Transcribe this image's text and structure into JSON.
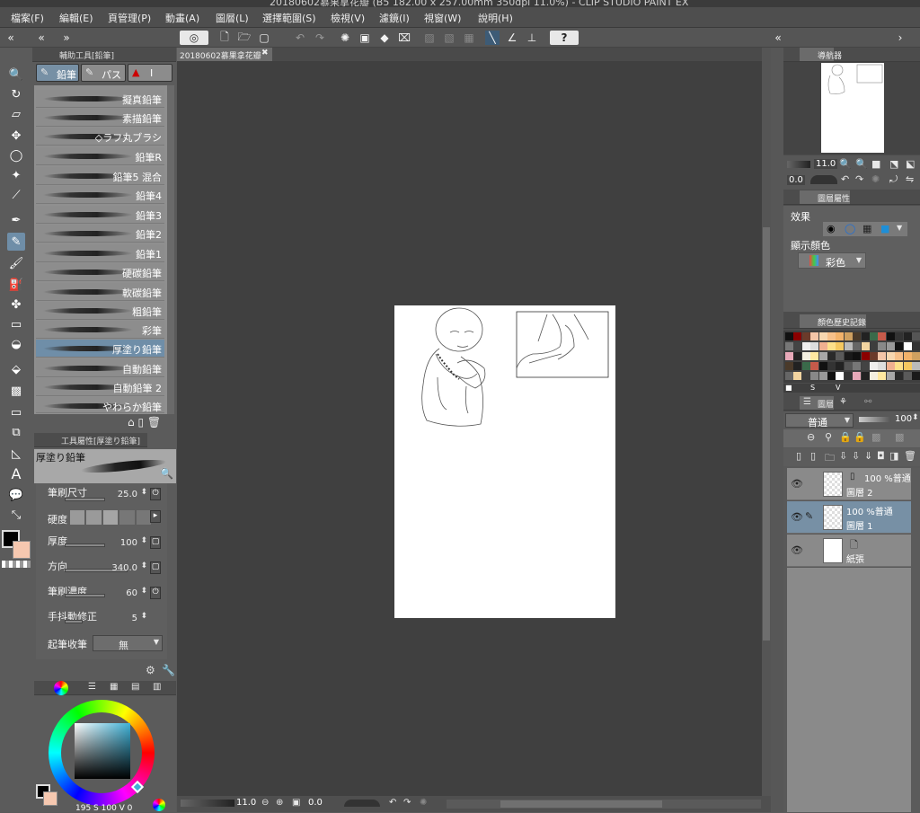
{
  "window": {
    "title": "20180602慕果拿花瓣 (B5 182.00 x 257.00mm 350dpi 11.0%) - CLIP STUDIO PAINT EX"
  },
  "menu": [
    "檔案(F)",
    "編輯(E)",
    "頁管理(P)",
    "動畫(A)",
    "圖層(L)",
    "選擇範圍(S)",
    "檢視(V)",
    "濾鏡(I)",
    "視窗(W)",
    "說明(H)"
  ],
  "document_tab": {
    "label": "20180602慕果拿花瓣"
  },
  "subtool_panel": {
    "title": "輔助工具[鉛筆]",
    "tabs": [
      "鉛筆",
      "パス",
      "I"
    ],
    "brushes": [
      "擬真鉛筆",
      "素描鉛筆",
      "◇ラフ丸ブラシ",
      "鉛筆R",
      "鉛筆5 混合",
      "鉛筆4",
      "鉛筆3",
      "鉛筆2",
      "鉛筆1",
      "硬碳鉛筆",
      "軟碳鉛筆",
      "粗鉛筆",
      "彩筆",
      "厚塗り鉛筆",
      "自動鉛筆",
      "自動鉛筆 2",
      "やわらか鉛筆"
    ],
    "selected": "厚塗り鉛筆"
  },
  "tool_property": {
    "title": "工具屬性[厚塗り鉛筆]",
    "brush_name": "厚塗り鉛筆",
    "brush_size": {
      "label": "筆刷尺寸",
      "value": "25.0"
    },
    "hardness": {
      "label": "硬度"
    },
    "thickness": {
      "label": "厚度",
      "value": "100"
    },
    "direction": {
      "label": "方向",
      "value": "340.0"
    },
    "density": {
      "label": "筆刷濃度",
      "value": "60"
    },
    "stabilization": {
      "label": "手抖動修正",
      "value": "5"
    },
    "start_end": {
      "label": "起筆收筆",
      "value": "無"
    }
  },
  "color_wheel": {
    "readout": "195 S 100 V 0",
    "square_color": "#3fb1d6"
  },
  "colors": {
    "main": "#000000",
    "sub": "#f6c8b0"
  },
  "navigator": {
    "title": "導航器",
    "zoom": "11.0",
    "rotation": "0.0"
  },
  "layer_property": {
    "title": "圖層屬性",
    "effect_label": "效果",
    "display_color_label": "顯示顏色",
    "display_color_value": "彩色"
  },
  "color_history": {
    "title": "顏色歷史記錄"
  },
  "layers": {
    "title": "圖層",
    "blend_mode": "普通",
    "opacity": "100",
    "items": [
      {
        "mode": "100 %普通",
        "name": "圖層 2"
      },
      {
        "mode": "100 %普通",
        "name": "圖層 1"
      },
      {
        "mode": "",
        "name": "紙張"
      }
    ]
  },
  "status_bar": {
    "zoom": "11.0",
    "rotation": "0.0"
  }
}
